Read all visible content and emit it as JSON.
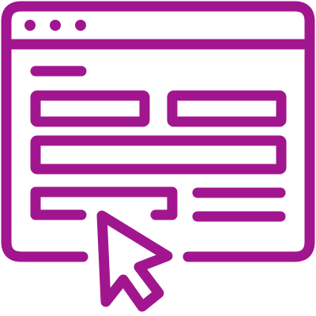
{
  "icon": {
    "name": "web-form-click-icon",
    "stroke_color": "#A1168F",
    "background_color": "#FFFFFF"
  },
  "browser": {
    "title_bar_dots": 3
  },
  "form": {
    "label_lines": 1,
    "input_fields": 4,
    "text_lines": 2
  },
  "cursor": {
    "icon": "mouse-pointer-icon"
  }
}
